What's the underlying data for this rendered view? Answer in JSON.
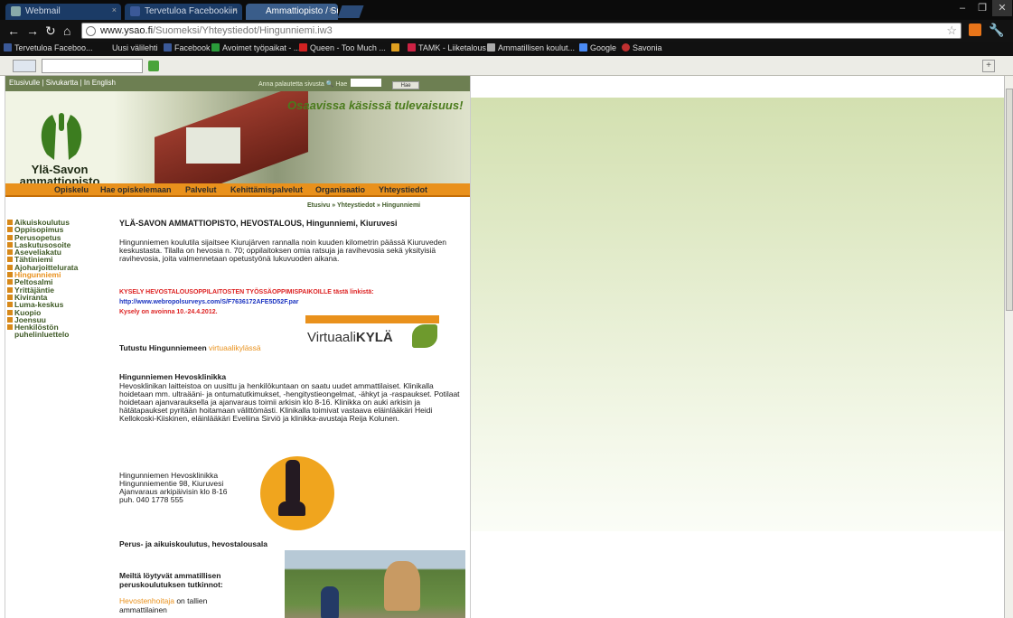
{
  "browser": {
    "tabs": [
      {
        "label": "Webmail"
      },
      {
        "label": "Tervetuloa Facebookiin"
      },
      {
        "label": "Ammattiopisto / Suomeksi"
      }
    ],
    "url_host": "www.ysao.fi",
    "url_path": "/Suomeksi/Yhteystiedot/Hingunniemi.iw3",
    "bookmarks": [
      {
        "label": "Tervetuloa Faceboo...",
        "color": "#3b5998"
      },
      {
        "label": "Uusi välilehti",
        "color": "#111111"
      },
      {
        "label": "Facebook",
        "color": "#3b5998"
      },
      {
        "label": "Avoimet työpaikat - ...",
        "color": "#2a9c3a"
      },
      {
        "label": "Queen - Too Much ...",
        "color": "#d22222"
      },
      {
        "label": "",
        "color": "#e0a020"
      },
      {
        "label": "TAMK - Liiketalous",
        "color": "#cc2244"
      },
      {
        "label": "Ammatillisen koulut...",
        "color": "#aaaaaa"
      },
      {
        "label": "Google",
        "color": "#4a8af4"
      },
      {
        "label": "Savonia",
        "color": "#c03030"
      }
    ]
  },
  "site": {
    "top_links": "Etusivulle | Sivukartta | In English",
    "top_right": "Anna palautetta sivusta",
    "search_label": "Hae",
    "search_button": "Hae",
    "slogan": "Osaavissa käsissä tulevaisuus!",
    "logo_line1": "Ylä-Savon",
    "logo_line2": "ammattiopisto",
    "menu": [
      "Opiskelu",
      "Hae opiskelemaan",
      "Palvelut",
      "Kehittämispalvelut",
      "Organisaatio",
      "Yhteystiedot"
    ],
    "sidenav": [
      "Aikuiskoulutus",
      "Oppisopimus",
      "Perusopetus",
      "Laskutusosoite",
      "Aseveliakatu",
      "Tähtiniemi",
      "Ajoharjoittelurata",
      "Hingunniemi",
      "Peltosalmi",
      "Yrittäjäntie",
      "Kiviranta",
      "Luma-keskus",
      "Kuopio",
      "Joensuu",
      "Henkilöstön puhelinluettelo"
    ],
    "breadcrumb": "Etusivu » Yhteystiedot » Hingunniemi",
    "heading": "YLÄ-SAVON AMMATTIOPISTO, HEVOSTALOUS, Hingunniemi, Kiuruvesi",
    "intro": "Hingunniemen koulutila sijaitsee Kiurujärven rannalla noin kuuden kilometrin päässä Kiuruveden keskustasta. Tilalla on hevosia n. 70; oppilaitoksen omia ratsuja ja ravihevosia sekä yksityisiä ravihevosia, joita valmennetaan opetustyönä lukuvuoden aikana.",
    "survey_line1": "KYSELY HEVOSTALOUSOPPILAITOSTEN TYÖSSÄOPPIMISPAIKOILLE tästä linkistä:",
    "survey_url": "http://www.webropolsurveys.com/S/F7636172AFE5D52F.par",
    "survey_line3": "Kysely on avoinna 10.-24.4.2012.",
    "virtual_prefix": "Tutustu Hingunniemeen",
    "virtual_link": "virtuaalikylässä",
    "virtual_logo_a": "Virtuaali",
    "virtual_logo_b": "KYLÄ",
    "clinic_title": "Hingunniemen Hevosklinikka",
    "clinic_text": "Hevosklinikan laitteistoa on uusittu ja henkilökuntaan on saatu uudet ammattilaiset. Klinikalla hoidetaan mm. ultraääni- ja ontumatutkimukset, -hengitystieongelmat, -ähkyt ja -raspaukset. Potilaat hoidetaan ajanvarauksella ja ajanvaraus toimii arkisin klo 8-16. Klinikka on auki arkisin ja hätätapaukset pyritään hoitamaan välittömästi. Klinikalla toimivat vastaava eläinlääkäri Heidi Kellokoski-Kiiskinen, eläinlääkäri Eveliina Sirviö ja klinikka-avustaja Reija Kolunen.",
    "address": [
      "Hingunniemen Hevosklinikka",
      "Hingunniementie 98, Kiuruvesi",
      "Ajanvaraus arkipäivisin klo 8-16",
      "puh. 040 1778 555"
    ],
    "section2": "Perus- ja aikuiskoulutus, hevostalousala",
    "qual_title": "Meiltä löytyvät ammatillisen peruskoulutuksen tutkinnot:",
    "qual_link": "Hevostenhoitaja",
    "qual_rest": " on tallien",
    "qual_line3": "ammattilainen"
  }
}
